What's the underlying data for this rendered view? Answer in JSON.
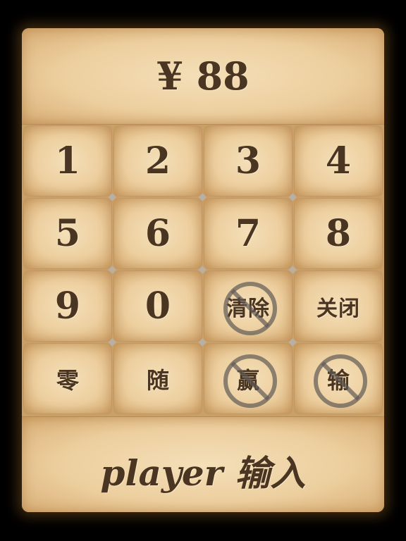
{
  "display": {
    "text": "¥ 88"
  },
  "keys": {
    "k1": "1",
    "k2": "2",
    "k3": "3",
    "k4": "4",
    "k5": "5",
    "k6": "6",
    "k7": "7",
    "k8": "8",
    "k9": "9",
    "k0": "0",
    "clear": "清除",
    "close": "关闭",
    "zero": "零",
    "random": "随",
    "win": "赢",
    "lose": "输"
  },
  "bottom": {
    "label": "player 输入"
  },
  "icons": {
    "disabled": "prohibited-icon"
  },
  "colors": {
    "text": "#4a3523",
    "parchment": "#edcf9f",
    "background": "#000000"
  }
}
